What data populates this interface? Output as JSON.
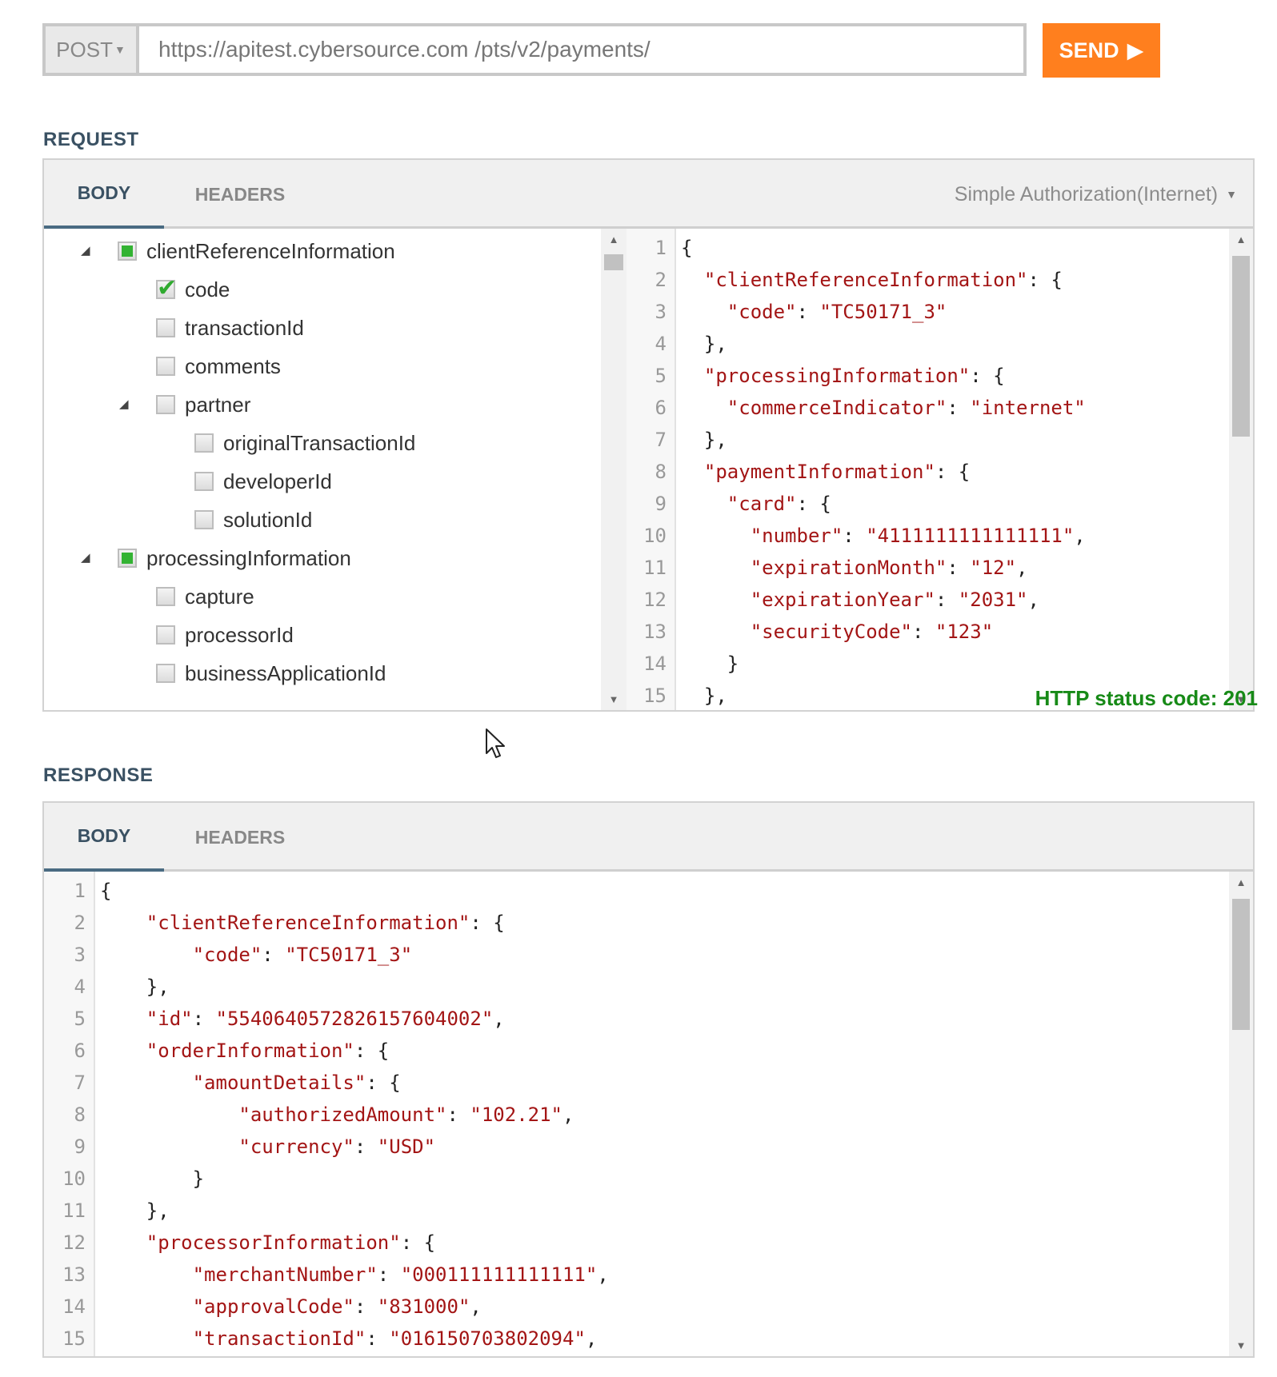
{
  "toolbar": {
    "method": "POST",
    "url": "https://apitest.cybersource.com /pts/v2/payments/",
    "send_label": "SEND"
  },
  "request": {
    "title": "REQUEST",
    "tabs": [
      "BODY",
      "HEADERS"
    ],
    "active_tab": "BODY",
    "sample_select": "Simple Authorization(Internet)",
    "tree": [
      {
        "label": "clientReferenceInformation",
        "level": 0,
        "state": "partial",
        "expanded": true
      },
      {
        "label": "code",
        "level": 1,
        "state": "checked"
      },
      {
        "label": "transactionId",
        "level": 1,
        "state": "unchecked"
      },
      {
        "label": "comments",
        "level": 1,
        "state": "unchecked"
      },
      {
        "label": "partner",
        "level": 1,
        "state": "unchecked",
        "expanded": true
      },
      {
        "label": "originalTransactionId",
        "level": 2,
        "state": "unchecked"
      },
      {
        "label": "developerId",
        "level": 2,
        "state": "unchecked"
      },
      {
        "label": "solutionId",
        "level": 2,
        "state": "unchecked"
      },
      {
        "label": "processingInformation",
        "level": 0,
        "state": "partial",
        "expanded": true
      },
      {
        "label": "capture",
        "level": 1,
        "state": "unchecked"
      },
      {
        "label": "processorId",
        "level": 1,
        "state": "unchecked"
      },
      {
        "label": "businessApplicationId",
        "level": 1,
        "state": "unchecked"
      }
    ],
    "code": [
      "{",
      "  \"clientReferenceInformation\": {",
      "    \"code\": \"TC50171_3\"",
      "  },",
      "  \"processingInformation\": {",
      "    \"commerceIndicator\": \"internet\"",
      "  },",
      "  \"paymentInformation\": {",
      "    \"card\": {",
      "      \"number\": \"4111111111111111\",",
      "      \"expirationMonth\": \"12\",",
      "      \"expirationYear\": \"2031\",",
      "      \"securityCode\": \"123\"",
      "    }",
      "  },"
    ]
  },
  "response": {
    "title": "RESPONSE",
    "status": "HTTP status code: 201",
    "status_color": "#178a17",
    "tabs": [
      "BODY",
      "HEADERS"
    ],
    "active_tab": "BODY",
    "code": [
      "{",
      "    \"clientReferenceInformation\": {",
      "        \"code\": \"TC50171_3\"",
      "    },",
      "    \"id\": \"5540640572826157604002\",",
      "    \"orderInformation\": {",
      "        \"amountDetails\": {",
      "            \"authorizedAmount\": \"102.21\",",
      "            \"currency\": \"USD\"",
      "        }",
      "    },",
      "    \"processorInformation\": {",
      "        \"merchantNumber\": \"000111111111111\",",
      "        \"approvalCode\": \"831000\",",
      "        \"transactionId\": \"016150703802094\","
    ]
  },
  "colors": {
    "send_button": "#ff7f1e",
    "json_key": "#a31515",
    "title": "#3a5163"
  }
}
